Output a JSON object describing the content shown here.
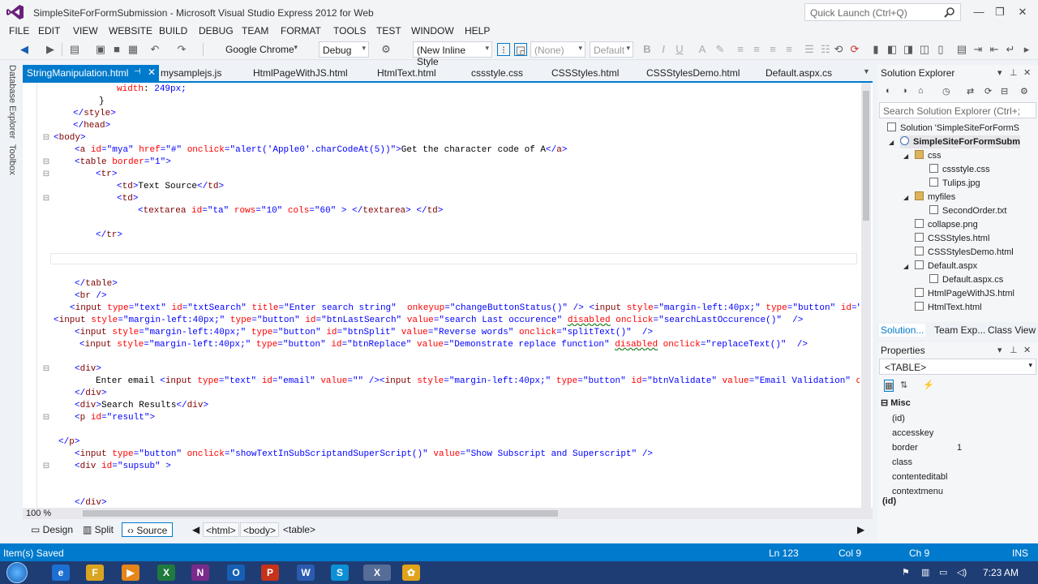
{
  "window": {
    "title": "SimpleSiteForFormSubmission - Microsoft Visual Studio Express 2012 for Web",
    "quick_launch_placeholder": "Quick Launch (Ctrl+Q)"
  },
  "menu": [
    "FILE",
    "EDIT",
    "VIEW",
    "WEBSITE",
    "BUILD",
    "DEBUG",
    "TEAM",
    "FORMAT",
    "TOOLS",
    "TEST",
    "WINDOW",
    "HELP"
  ],
  "toolbar": {
    "browser": "Google Chrome",
    "config": "Debug",
    "style_mode": "(New Inline Style",
    "target": "(None)",
    "default": "Default"
  },
  "side_tabs": [
    "Database Explorer",
    "Toolbox"
  ],
  "doc_tabs": [
    {
      "label": "StringManipulation.html",
      "active": true
    },
    {
      "label": "mysamplejs.js"
    },
    {
      "label": "HtmlPageWithJS.html"
    },
    {
      "label": "HtmlText.html"
    },
    {
      "label": "cssstyle.css"
    },
    {
      "label": "CSSStyles.html"
    },
    {
      "label": "CSSStylesDemo.html"
    },
    {
      "label": "Default.aspx.cs"
    }
  ],
  "code_lines": [
    "width: 249px;",
    "}",
    "</style>",
    "</head>",
    "<body>",
    "<a id=\"mya\" href=\"#\" onclick=\"alert('Apple0'.charCodeAt(5))\">Get the character code of A</a>",
    "<table border=\"1\">",
    "<tr>",
    "<td>Text Source</td>",
    "<td>",
    "<textarea id=\"ta\" rows=\"10\" cols=\"60\" > </textarea> </td>",
    "",
    "</tr>",
    "",
    "",
    "",
    "</table>",
    "<br />",
    "<input type=\"text\" id=\"txtSearch\" title=\"Enter search string\"  onkeyup=\"changeButtonStatus()\" /> <input style=\"margin-left:40px;\" type=\"button\" id=\"s",
    "<input style=\"margin-left:40px;\" type=\"button\" id=\"btnLastSearch\" value=\"search Last occurence\" disabled onclick=\"searchLastOccurence()\"  />",
    "<input style=\"margin-left:40px;\" type=\"button\" id=\"btnSplit\" value=\"Reverse words\" onclick=\"splitText()\"  />",
    "<input style=\"margin-left:40px;\" type=\"button\" id=\"btnReplace\" value=\"Demonstrate replace function\" disabled onclick=\"replaceText()\"  />",
    "",
    "<div>",
    "Enter email <input type=\"text\" id=\"email\" value=\"\" /><input style=\"margin-left:40px;\" type=\"button\" id=\"btnValidate\" value=\"Email Validation\" on",
    "</div>",
    "<div>Search Results</div>",
    "<p id=\"result\">",
    "",
    "</p>",
    "<input type=\"button\" onclick=\"showTextInSubScriptandSuperScript()\" value=\"Show Subscript and Superscript\" />",
    "<div id=\"supsub\" >",
    "",
    "",
    "</div>"
  ],
  "editor": {
    "zoom": "100 %",
    "view_buttons": [
      "Design",
      "Split",
      "Source"
    ],
    "breadcrumbs": [
      "<html>",
      "<body>",
      "<table>"
    ]
  },
  "solution_explorer": {
    "title": "Solution Explorer",
    "search_placeholder": "Search Solution Explorer (Ctrl+;",
    "items": [
      {
        "label": "Solution 'SimpleSiteForFormS",
        "icon": "solution-icon"
      },
      {
        "label": "SimpleSiteForFormSubm",
        "icon": "globe-icon",
        "selected": true
      },
      {
        "label": "css",
        "icon": "folder-icon"
      },
      {
        "label": "cssstyle.css",
        "icon": "file-icon"
      },
      {
        "label": "Tulips.jpg",
        "icon": "image-icon"
      },
      {
        "label": "myfiles",
        "icon": "folder-icon"
      },
      {
        "label": "SecondOrder.txt",
        "icon": "file-icon"
      },
      {
        "label": "collapse.png",
        "icon": "image-icon"
      },
      {
        "label": "CSSStyles.html",
        "icon": "file-icon"
      },
      {
        "label": "CSSStylesDemo.html",
        "icon": "file-icon"
      },
      {
        "label": "Default.aspx",
        "icon": "file-icon"
      },
      {
        "label": "Default.aspx.cs",
        "icon": "file-icon"
      },
      {
        "label": "HtmlPageWithJS.html",
        "icon": "file-icon"
      },
      {
        "label": "HtmlText.html",
        "icon": "file-icon"
      }
    ],
    "tabs": [
      "Solution...",
      "Team Exp...",
      "Class View"
    ]
  },
  "properties": {
    "title": "Properties",
    "selected": "<TABLE>",
    "category": "Misc",
    "rows": [
      {
        "name": "(id)",
        "value": ""
      },
      {
        "name": "accesskey",
        "value": ""
      },
      {
        "name": "border",
        "value": "1"
      },
      {
        "name": "class",
        "value": ""
      },
      {
        "name": "contenteditabl",
        "value": ""
      },
      {
        "name": "contextmenu",
        "value": ""
      }
    ],
    "description": "(id)"
  },
  "status": {
    "message": "Item(s) Saved",
    "line": "Ln 123",
    "col": "Col 9",
    "ch": "Ch 9",
    "mode": "INS"
  },
  "taskbar": {
    "apps": [
      "e",
      "F",
      "▶",
      "X",
      "N",
      "O",
      "P",
      "W",
      "S",
      "X",
      "✿"
    ],
    "clock": "7:23 AM"
  },
  "colors": {
    "accent": "#007acc",
    "tag": "#800000",
    "attr": "#ff0000",
    "value": "#0000ff",
    "taskbar": "#1e3d75"
  }
}
